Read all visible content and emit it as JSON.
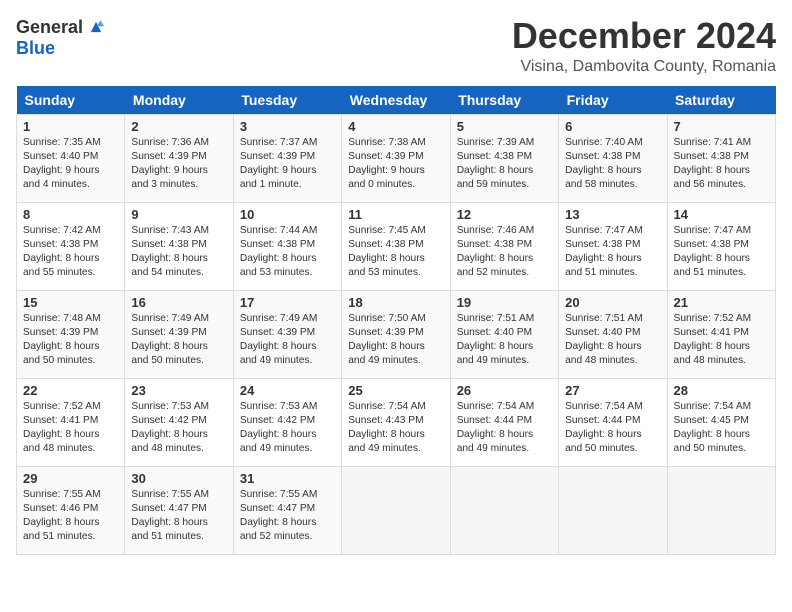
{
  "logo": {
    "general": "General",
    "blue": "Blue"
  },
  "title": "December 2024",
  "location": "Visina, Dambovita County, Romania",
  "days_of_week": [
    "Sunday",
    "Monday",
    "Tuesday",
    "Wednesday",
    "Thursday",
    "Friday",
    "Saturday"
  ],
  "weeks": [
    [
      {
        "day": "1",
        "sunrise": "7:35 AM",
        "sunset": "4:40 PM",
        "daylight": "9 hours and 4 minutes."
      },
      {
        "day": "2",
        "sunrise": "7:36 AM",
        "sunset": "4:39 PM",
        "daylight": "9 hours and 3 minutes."
      },
      {
        "day": "3",
        "sunrise": "7:37 AM",
        "sunset": "4:39 PM",
        "daylight": "9 hours and 1 minute."
      },
      {
        "day": "4",
        "sunrise": "7:38 AM",
        "sunset": "4:39 PM",
        "daylight": "9 hours and 0 minutes."
      },
      {
        "day": "5",
        "sunrise": "7:39 AM",
        "sunset": "4:38 PM",
        "daylight": "8 hours and 59 minutes."
      },
      {
        "day": "6",
        "sunrise": "7:40 AM",
        "sunset": "4:38 PM",
        "daylight": "8 hours and 58 minutes."
      },
      {
        "day": "7",
        "sunrise": "7:41 AM",
        "sunset": "4:38 PM",
        "daylight": "8 hours and 56 minutes."
      }
    ],
    [
      {
        "day": "8",
        "sunrise": "7:42 AM",
        "sunset": "4:38 PM",
        "daylight": "8 hours and 55 minutes."
      },
      {
        "day": "9",
        "sunrise": "7:43 AM",
        "sunset": "4:38 PM",
        "daylight": "8 hours and 54 minutes."
      },
      {
        "day": "10",
        "sunrise": "7:44 AM",
        "sunset": "4:38 PM",
        "daylight": "8 hours and 53 minutes."
      },
      {
        "day": "11",
        "sunrise": "7:45 AM",
        "sunset": "4:38 PM",
        "daylight": "8 hours and 53 minutes."
      },
      {
        "day": "12",
        "sunrise": "7:46 AM",
        "sunset": "4:38 PM",
        "daylight": "8 hours and 52 minutes."
      },
      {
        "day": "13",
        "sunrise": "7:47 AM",
        "sunset": "4:38 PM",
        "daylight": "8 hours and 51 minutes."
      },
      {
        "day": "14",
        "sunrise": "7:47 AM",
        "sunset": "4:38 PM",
        "daylight": "8 hours and 51 minutes."
      }
    ],
    [
      {
        "day": "15",
        "sunrise": "7:48 AM",
        "sunset": "4:39 PM",
        "daylight": "8 hours and 50 minutes."
      },
      {
        "day": "16",
        "sunrise": "7:49 AM",
        "sunset": "4:39 PM",
        "daylight": "8 hours and 50 minutes."
      },
      {
        "day": "17",
        "sunrise": "7:49 AM",
        "sunset": "4:39 PM",
        "daylight": "8 hours and 49 minutes."
      },
      {
        "day": "18",
        "sunrise": "7:50 AM",
        "sunset": "4:39 PM",
        "daylight": "8 hours and 49 minutes."
      },
      {
        "day": "19",
        "sunrise": "7:51 AM",
        "sunset": "4:40 PM",
        "daylight": "8 hours and 49 minutes."
      },
      {
        "day": "20",
        "sunrise": "7:51 AM",
        "sunset": "4:40 PM",
        "daylight": "8 hours and 48 minutes."
      },
      {
        "day": "21",
        "sunrise": "7:52 AM",
        "sunset": "4:41 PM",
        "daylight": "8 hours and 48 minutes."
      }
    ],
    [
      {
        "day": "22",
        "sunrise": "7:52 AM",
        "sunset": "4:41 PM",
        "daylight": "8 hours and 48 minutes."
      },
      {
        "day": "23",
        "sunrise": "7:53 AM",
        "sunset": "4:42 PM",
        "daylight": "8 hours and 48 minutes."
      },
      {
        "day": "24",
        "sunrise": "7:53 AM",
        "sunset": "4:42 PM",
        "daylight": "8 hours and 49 minutes."
      },
      {
        "day": "25",
        "sunrise": "7:54 AM",
        "sunset": "4:43 PM",
        "daylight": "8 hours and 49 minutes."
      },
      {
        "day": "26",
        "sunrise": "7:54 AM",
        "sunset": "4:44 PM",
        "daylight": "8 hours and 49 minutes."
      },
      {
        "day": "27",
        "sunrise": "7:54 AM",
        "sunset": "4:44 PM",
        "daylight": "8 hours and 50 minutes."
      },
      {
        "day": "28",
        "sunrise": "7:54 AM",
        "sunset": "4:45 PM",
        "daylight": "8 hours and 50 minutes."
      }
    ],
    [
      {
        "day": "29",
        "sunrise": "7:55 AM",
        "sunset": "4:46 PM",
        "daylight": "8 hours and 51 minutes."
      },
      {
        "day": "30",
        "sunrise": "7:55 AM",
        "sunset": "4:47 PM",
        "daylight": "8 hours and 51 minutes."
      },
      {
        "day": "31",
        "sunrise": "7:55 AM",
        "sunset": "4:47 PM",
        "daylight": "8 hours and 52 minutes."
      },
      null,
      null,
      null,
      null
    ]
  ]
}
